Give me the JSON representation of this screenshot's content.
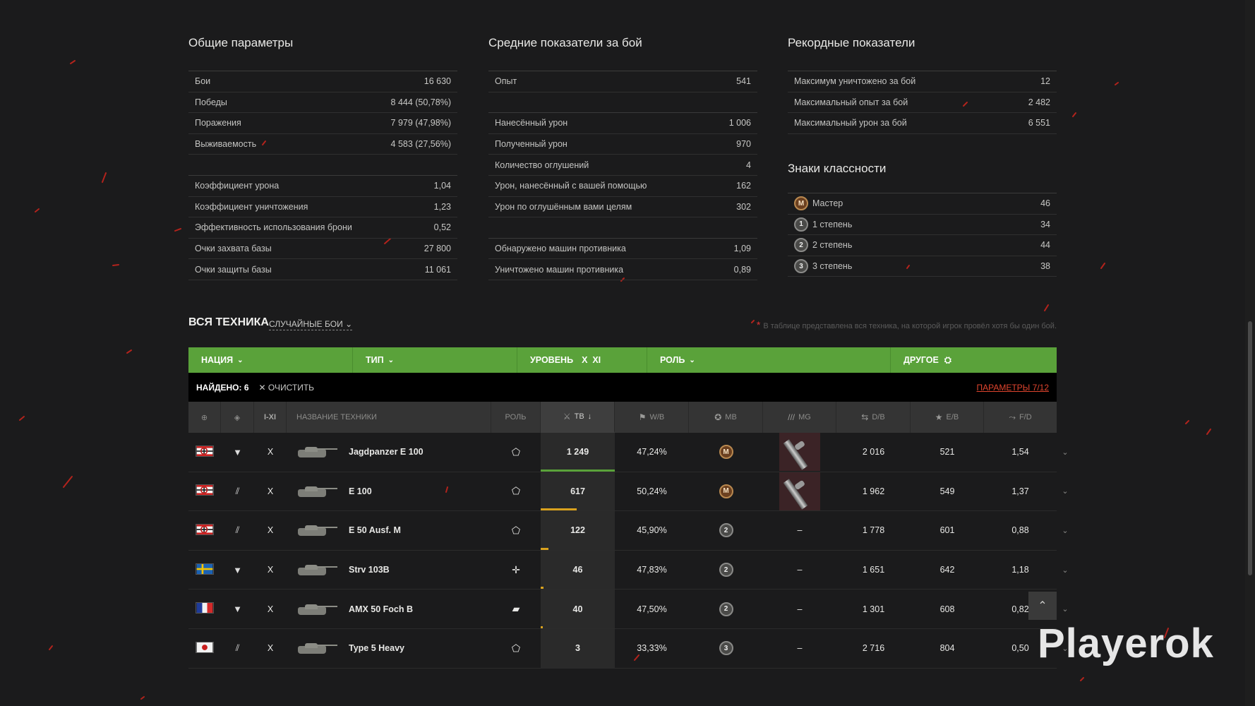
{
  "general": {
    "title": "Общие параметры",
    "rows1": [
      {
        "label": "Бои",
        "value": "16 630"
      },
      {
        "label": "Победы",
        "value": "8 444 (50,78%)"
      },
      {
        "label": "Поражения",
        "value": "7 979 (47,98%)"
      },
      {
        "label": "Выживаемость",
        "value": "4 583 (27,56%)"
      }
    ],
    "rows2": [
      {
        "label": "Коэффициент урона",
        "value": "1,04"
      },
      {
        "label": "Коэффициент уничтожения",
        "value": "1,23"
      },
      {
        "label": "Эффективность использования брони",
        "value": "0,52"
      },
      {
        "label": "Очки захвата базы",
        "value": "27 800"
      },
      {
        "label": "Очки защиты базы",
        "value": "11 061"
      }
    ]
  },
  "average": {
    "title": "Средние показатели за бой",
    "rows1": [
      {
        "label": "Опыт",
        "value": "541"
      }
    ],
    "rows2": [
      {
        "label": "Нанесённый урон",
        "value": "1 006"
      },
      {
        "label": "Полученный урон",
        "value": "970"
      },
      {
        "label": "Количество оглушений",
        "value": "4"
      },
      {
        "label": "Урон, нанесённый с вашей помощью",
        "value": "162"
      },
      {
        "label": "Урон по оглушённым вами целям",
        "value": "302"
      }
    ],
    "rows3": [
      {
        "label": "Обнаружено машин противника",
        "value": "1,09"
      },
      {
        "label": "Уничтожено машин противника",
        "value": "0,89"
      }
    ]
  },
  "records": {
    "title": "Рекордные показатели",
    "rows": [
      {
        "label": "Максимум уничтожено за бой",
        "value": "12"
      },
      {
        "label": "Максимальный опыт за бой",
        "value": "2 482"
      },
      {
        "label": "Максимальный урон за бой",
        "value": "6 551"
      }
    ]
  },
  "marks": {
    "title": "Знаки классности",
    "rows": [
      {
        "badge": "M",
        "label": "Мастер",
        "value": "46"
      },
      {
        "badge": "1",
        "label": "1 степень",
        "value": "34"
      },
      {
        "badge": "2",
        "label": "2 степень",
        "value": "44"
      },
      {
        "badge": "3",
        "label": "3 степень",
        "value": "38"
      }
    ]
  },
  "vehicles": {
    "title": "ВСЯ ТЕХНИКА",
    "mode": "СЛУЧАЙНЫЕ БОИ",
    "note": "В таблице представлена вся техника, на которой игрок провёл хотя бы один бой.",
    "filters": {
      "nation": "НАЦИЯ",
      "type": "ТИП",
      "level": "УРОВЕНЬ",
      "level_value": "X  XI",
      "role": "РОЛЬ",
      "other": "ДРУГОЕ"
    },
    "found": "НАЙДЕНО: 6",
    "clear": "ОЧИСТИТЬ",
    "params": "ПАРАМЕТРЫ 7/12",
    "headers": {
      "tier": "I-XI",
      "name": "НАЗВАНИЕ ТЕХНИКИ",
      "role": "РОЛЬ",
      "battles": "ТВ",
      "wr": "W/B",
      "mastery": "МВ",
      "mg": "MG",
      "db": "D/B",
      "eb": "E/B",
      "fd": "F/D"
    },
    "rows": [
      {
        "nation": "germany",
        "type": "td",
        "tier": "X",
        "name": "Jagdpanzer E 100",
        "role": "pentagon",
        "battles": "1 249",
        "progress": 1.0,
        "bar_color": "#5aa23a",
        "wr": "47,24%",
        "mastery": "M",
        "mg": true,
        "mg_text": "",
        "db": "2 016",
        "eb": "521",
        "fd": "1,54"
      },
      {
        "nation": "germany",
        "type": "heavy",
        "tier": "X",
        "name": "E 100",
        "role": "pentagon",
        "battles": "617",
        "progress": 0.49,
        "bar_color": "#d9a21e",
        "wr": "50,24%",
        "mastery": "M",
        "mg": true,
        "mg_text": "",
        "db": "1 962",
        "eb": "549",
        "fd": "1,37"
      },
      {
        "nation": "germany",
        "type": "medium",
        "tier": "X",
        "name": "E 50 Ausf. M",
        "role": "pentagon",
        "battles": "122",
        "progress": 0.1,
        "bar_color": "#d9a21e",
        "wr": "45,90%",
        "mastery": "2",
        "mg": false,
        "mg_text": "–",
        "db": "1 778",
        "eb": "601",
        "fd": "0,88"
      },
      {
        "nation": "sweden",
        "type": "td",
        "tier": "X",
        "name": "Strv 103B",
        "role": "cross",
        "battles": "46",
        "progress": 0.04,
        "bar_color": "#d9a21e",
        "wr": "47,83%",
        "mastery": "2",
        "mg": false,
        "mg_text": "–",
        "db": "1 651",
        "eb": "642",
        "fd": "1,18"
      },
      {
        "nation": "france",
        "type": "td",
        "tier": "X",
        "name": "AMX 50 Foch B",
        "role": "stack",
        "battles": "40",
        "progress": 0.03,
        "bar_color": "#d9a21e",
        "wr": "47,50%",
        "mastery": "2",
        "mg": false,
        "mg_text": "–",
        "db": "1 301",
        "eb": "608",
        "fd": "0,82"
      },
      {
        "nation": "japan",
        "type": "heavy",
        "tier": "X",
        "name": "Type 5 Heavy",
        "role": "pentagon",
        "battles": "3",
        "progress": 0.0,
        "bar_color": "#d9a21e",
        "wr": "33,33%",
        "mastery": "3",
        "mg": false,
        "mg_text": "–",
        "db": "2 716",
        "eb": "804",
        "fd": "0,50"
      }
    ]
  },
  "logo": "Playerok"
}
